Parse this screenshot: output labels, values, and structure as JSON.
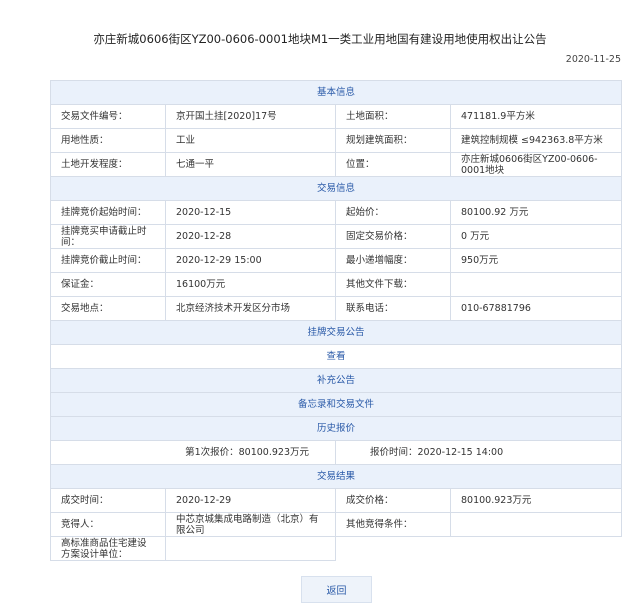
{
  "page": {
    "title": "亦庄新城0606街区YZ00-0606-0001地块M1一类工业用地国有建设用地使用权出让公告",
    "date": "2020-11-25"
  },
  "basic": {
    "header": "基本信息",
    "doc_no_label": "交易文件编号：",
    "doc_no": "京开国土挂[2020]17号",
    "land_area_label": "土地面积：",
    "land_area": "471181.9平方米",
    "land_use_label": "用地性质：",
    "land_use": "工业",
    "plan_area_label": "规划建筑面积：",
    "plan_area": "建筑控制规模 ≤942363.8平方米",
    "dev_level_label": "土地开发程度：",
    "dev_level": "七通一平",
    "location_label": "位置：",
    "location": "亦庄新城0606街区YZ00-0606-0001地块"
  },
  "trade": {
    "header": "交易信息",
    "start_time_label": "挂牌竞价起始时间：",
    "start_time": "2020-12-15",
    "start_price_label": "起始价：",
    "start_price": "80100.92 万元",
    "apply_deadline_label": "挂牌竞买申请截止时间：",
    "apply_deadline": "2020-12-28",
    "fixed_price_label": "固定交易价格：",
    "fixed_price": "0 万元",
    "end_time_label": "挂牌竞价截止时间：",
    "end_time": "2020-12-29 15:00",
    "min_increment_label": "最小递增幅度：",
    "min_increment": "950万元",
    "deposit_label": "保证金：",
    "deposit": "16100万元",
    "other_docs_label": "其他文件下载：",
    "other_docs": "",
    "place_label": "交易地点：",
    "place": "北京经济技术开发区分市场",
    "phone_label": "联系电话：",
    "phone": "010-67881796"
  },
  "links": {
    "listing_notice": "挂牌交易公告",
    "view": "查看",
    "supplement": "补充公告",
    "memo": "备忘录和交易文件"
  },
  "history": {
    "header": "历史报价",
    "quote": "第1次报价：80100.923万元",
    "quote_time": "报价时间：2020-12-15 14:00"
  },
  "result": {
    "header": "交易结果",
    "deal_time_label": "成交时间：",
    "deal_time": "2020-12-29",
    "deal_price_label": "成交价格：",
    "deal_price": "80100.923万元",
    "winner_label": "竞得人：",
    "winner": "中芯京城集成电路制造（北京）有限公司",
    "other_cond_label": "其他竞得条件：",
    "other_cond": "",
    "design_unit_label": "高标准商品住宅建设方案设计单位：",
    "design_unit": ""
  },
  "buttons": {
    "back": "返回"
  }
}
